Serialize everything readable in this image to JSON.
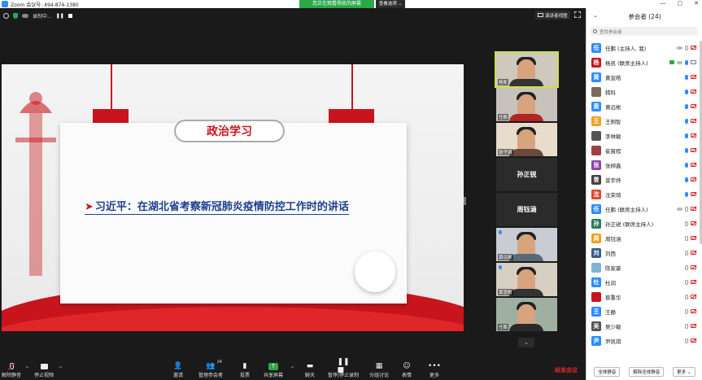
{
  "window": {
    "title": "Zoom 会议号: 494-874-1380",
    "controls": [
      "—",
      "▢",
      "✕"
    ]
  },
  "share_banner": "您正在观看杨凯的屏幕",
  "view_options": "查看选项 ⌄",
  "top_info": {
    "recording": "录制中..."
  },
  "gallery_button": "演讲者视图",
  "slide": {
    "section_title": "政治学习",
    "headline_arrow": "➤",
    "headline": "习近平：在湖北省考察新冠肺炎疫情防控工作时的讲话"
  },
  "thumbnails": [
    {
      "name": "杨凯",
      "type": "video",
      "active": true
    },
    {
      "name": "任鹏",
      "type": "video",
      "active": false
    },
    {
      "name": "张子涵",
      "type": "video",
      "active": false
    },
    {
      "name": "孙正锐",
      "type": "name",
      "active": false
    },
    {
      "name": "周钰涵",
      "type": "name",
      "active": false
    },
    {
      "name": "黄远彬",
      "type": "video",
      "active": false
    },
    {
      "name": "黄宣皓",
      "type": "video",
      "active": false
    },
    {
      "name": "任鹏",
      "type": "video",
      "active": false
    }
  ],
  "thumb_scroll": "⌄",
  "toolbar": {
    "unmute": "解除静音",
    "stop_video": "停止视频",
    "invite": "邀请",
    "manage_participants": "管理参会者",
    "participant_count": "24",
    "poll": "投票",
    "share_screen": "共享屏幕",
    "chat": "聊天",
    "recording": "暂停/停止录制",
    "breakout": "分组讨论",
    "reactions": "表情",
    "more": "更多",
    "end": "结束会议"
  },
  "panel": {
    "title": "参会者 (24)",
    "search_placeholder": "查找参会者",
    "participants": [
      {
        "initial": "任",
        "name": "任鹏 (主持人, 我)",
        "color": "#2d8cff",
        "mic": "grey",
        "video": "off",
        "cloud": true
      },
      {
        "initial": "杨",
        "name": "杨凯 (联席主持人)",
        "color": "#c8151d",
        "mic": "on",
        "video": "on",
        "cloud": true,
        "sharing": true
      },
      {
        "initial": "黄",
        "name": "黄宣皓",
        "color": "#2d8cff",
        "mic": "on",
        "video": "off"
      },
      {
        "initial": "",
        "name": "韩科",
        "color": "#7b6a55",
        "mic": "on",
        "video": "off"
      },
      {
        "initial": "黄",
        "name": "黄远彬",
        "color": "#2d8cff",
        "mic": "on",
        "video": "off"
      },
      {
        "initial": "王",
        "name": "王俐智",
        "color": "#f0a020",
        "mic": "on",
        "video": "off"
      },
      {
        "initial": "",
        "name": "李林敏",
        "color": "#555555",
        "mic": "on",
        "video": "off"
      },
      {
        "initial": "",
        "name": "崔賀程",
        "color": "#a04040",
        "mic": "on",
        "video": "off"
      },
      {
        "initial": "张",
        "name": "张柳鑫",
        "color": "#8e44ad",
        "mic": "on",
        "video": "off"
      },
      {
        "initial": "曾",
        "name": "曾宇烨",
        "color": "#444444",
        "mic": "on",
        "video": "off"
      },
      {
        "initial": "沈",
        "name": "沈荣琦",
        "color": "#e0452c",
        "mic": "on",
        "video": "off"
      },
      {
        "initial": "任",
        "name": "任鹏 (联席主持人)",
        "color": "#2d8cff",
        "mic": "grey",
        "video": "off",
        "cloud": true
      },
      {
        "initial": "孙",
        "name": "孙正锐 (联席主持人)",
        "color": "#2a7a5a",
        "mic": "grey",
        "video": "off"
      },
      {
        "initial": "周",
        "name": "周钰涵",
        "color": "#f0a020",
        "mic": "grey",
        "video": "off"
      },
      {
        "initial": "刘",
        "name": "刘西",
        "color": "#3a5a8a",
        "mic": "grey",
        "video": "off"
      },
      {
        "initial": "",
        "name": "陈家豪",
        "color": "#7fb3d5",
        "mic": "grey",
        "video": "off"
      },
      {
        "initial": "杜",
        "name": "杜润",
        "color": "#2d8cff",
        "mic": "grey",
        "video": "off"
      },
      {
        "initial": "",
        "name": "蔡重华",
        "color": "#c8151d",
        "mic": "grey",
        "video": "off"
      },
      {
        "initial": "王",
        "name": "王静",
        "color": "#2d8cff",
        "mic": "grey",
        "video": "off"
      },
      {
        "initial": "吴",
        "name": "吴少敏",
        "color": "#555555",
        "mic": "grey",
        "video": "off"
      },
      {
        "initial": "尹",
        "name": "尹凯琪",
        "color": "#2d8cff",
        "mic": "grey",
        "video": "off"
      }
    ],
    "footer": {
      "mute_all": "全体静音",
      "unmute_all": "解除全体静音",
      "more": "更多 ⌄"
    }
  },
  "colors": {
    "accent": "#2d8cff",
    "green": "#2ca84a",
    "red": "#e02828",
    "slide_red": "#c8151d",
    "slide_blue": "#1b3f8f"
  }
}
